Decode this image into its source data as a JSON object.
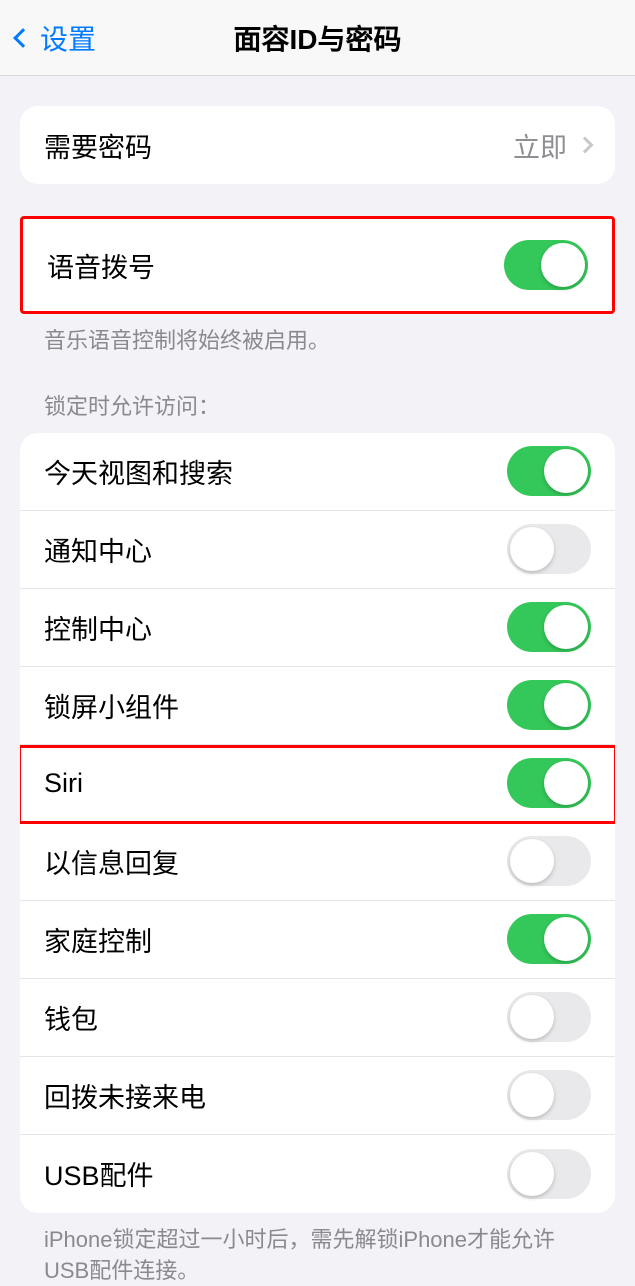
{
  "nav": {
    "back": "设置",
    "title": "面容ID与密码"
  },
  "require_passcode": {
    "label": "需要密码",
    "value": "立即"
  },
  "voice_dial": {
    "label": "语音拨号",
    "enabled": true,
    "footer": "音乐语音控制将始终被启用。"
  },
  "lock_access": {
    "header": "锁定时允许访问：",
    "items": [
      {
        "label": "今天视图和搜索",
        "enabled": true,
        "highlighted": false
      },
      {
        "label": "通知中心",
        "enabled": false,
        "highlighted": false
      },
      {
        "label": "控制中心",
        "enabled": true,
        "highlighted": false
      },
      {
        "label": "锁屏小组件",
        "enabled": true,
        "highlighted": false
      },
      {
        "label": "Siri",
        "enabled": true,
        "highlighted": true
      },
      {
        "label": "以信息回复",
        "enabled": false,
        "highlighted": false
      },
      {
        "label": "家庭控制",
        "enabled": true,
        "highlighted": false
      },
      {
        "label": "钱包",
        "enabled": false,
        "highlighted": false
      },
      {
        "label": "回拨未接来电",
        "enabled": false,
        "highlighted": false
      },
      {
        "label": "USB配件",
        "enabled": false,
        "highlighted": false
      }
    ],
    "footer": "iPhone锁定超过一小时后，需先解锁iPhone才能允许USB配件连接。"
  }
}
